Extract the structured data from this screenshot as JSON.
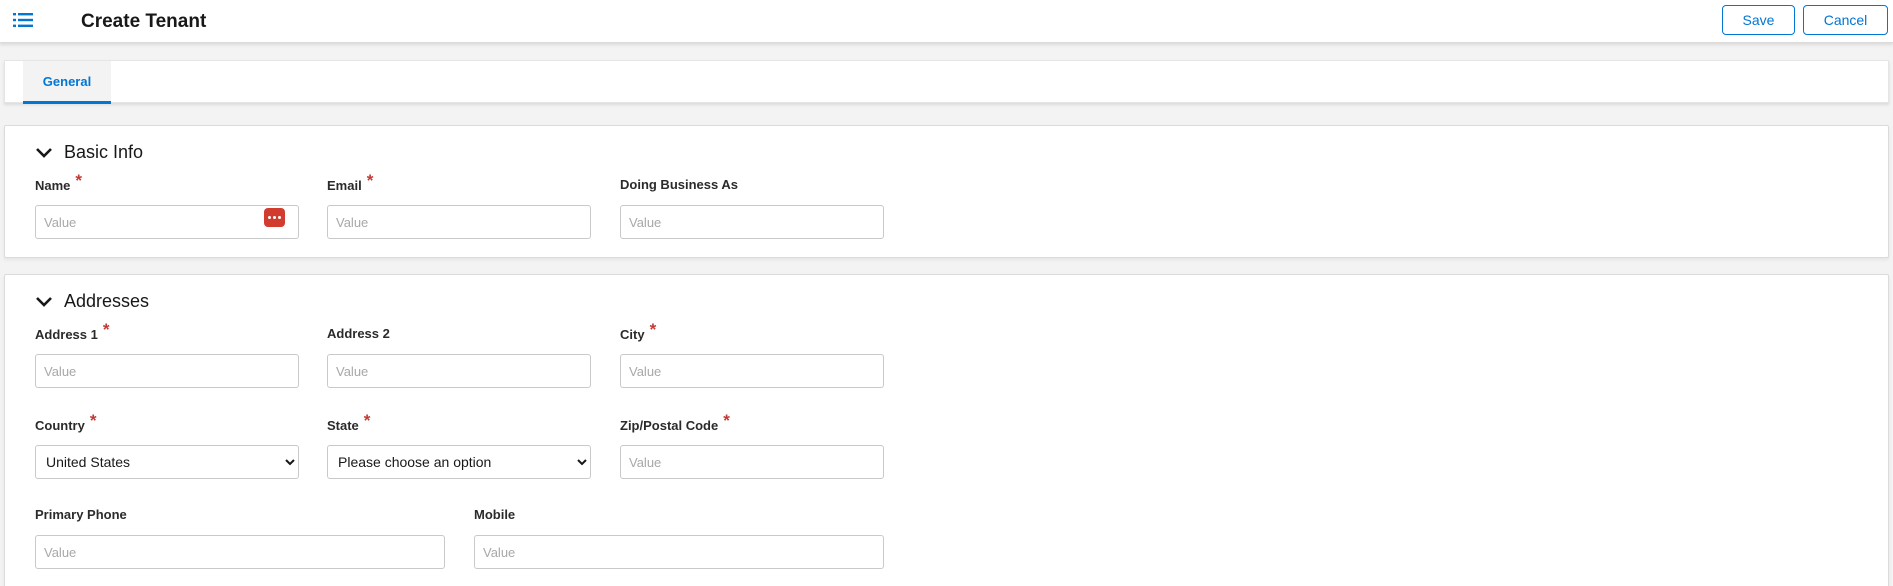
{
  "header": {
    "title": "Create Tenant",
    "save_label": "Save",
    "cancel_label": "Cancel"
  },
  "tabs": [
    {
      "label": "General",
      "active": true
    }
  ],
  "basic_info": {
    "title": "Basic Info",
    "name": {
      "label": "Name",
      "required": "*",
      "placeholder": "Value"
    },
    "email": {
      "label": "Email",
      "required": "*",
      "placeholder": "Value"
    },
    "dba": {
      "label": "Doing Business As",
      "placeholder": "Value"
    }
  },
  "addresses": {
    "title": "Addresses",
    "address1": {
      "label": "Address 1",
      "required": "*",
      "placeholder": "Value"
    },
    "address2": {
      "label": "Address 2",
      "placeholder": "Value"
    },
    "city": {
      "label": "City",
      "required": "*",
      "placeholder": "Value"
    },
    "country": {
      "label": "Country",
      "required": "*",
      "selected": "United States"
    },
    "state": {
      "label": "State",
      "required": "*",
      "selected": "Please choose an option"
    },
    "zip": {
      "label": "Zip/Postal Code",
      "required": "*",
      "placeholder": "Value"
    },
    "primary_phone": {
      "label": "Primary Phone",
      "placeholder": "Value"
    },
    "mobile": {
      "label": "Mobile",
      "placeholder": "Value"
    }
  },
  "colors": {
    "accent": "#0176d3",
    "required": "#c23934",
    "password_icon": "#d13c2f"
  },
  "icons": {
    "menu": "list-icon",
    "section_toggle": "chevron-down-icon",
    "password_manager": "password-manager-icon"
  }
}
